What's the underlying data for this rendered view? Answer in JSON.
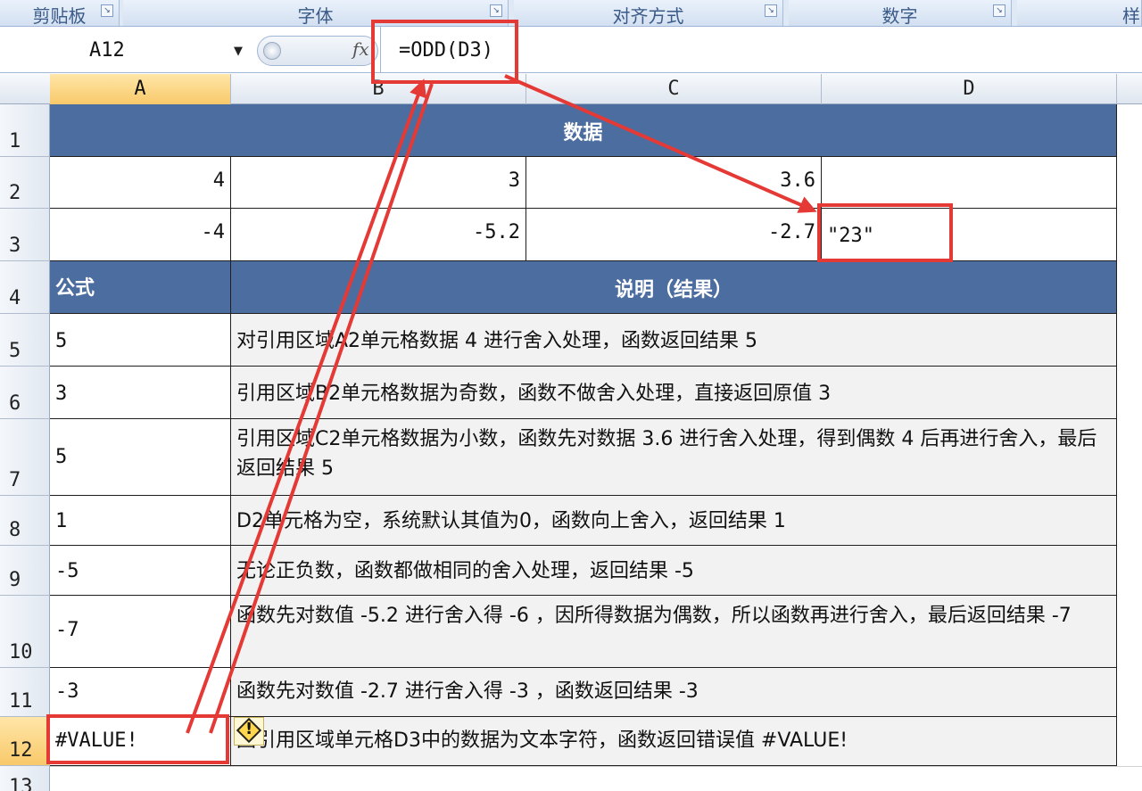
{
  "ribbon": {
    "groups": [
      {
        "label": "剪贴板"
      },
      {
        "label": "字体"
      },
      {
        "label": "对齐方式"
      },
      {
        "label": "数字"
      },
      {
        "label": "样"
      }
    ]
  },
  "formula_bar": {
    "name_box": "A12",
    "fx_label": "fx",
    "formula": "=ODD(D3)"
  },
  "columns": [
    "A",
    "B",
    "C",
    "D"
  ],
  "active_column": "A",
  "rows": [
    "1",
    "2",
    "3",
    "4",
    "5",
    "6",
    "7",
    "8",
    "9",
    "10",
    "11",
    "12",
    "13"
  ],
  "active_row": "12",
  "sheet": {
    "data_header": "数据",
    "r2": {
      "a": "4",
      "b": "3",
      "c": "3.6",
      "d": ""
    },
    "r3": {
      "a": "-4",
      "b": "-5.2",
      "c": "-2.7",
      "d": "\"23\""
    },
    "formula_header": "公式",
    "desc_header": "说明（结果）",
    "items": [
      {
        "result": "5",
        "desc": "对引用区域A2单元格数据 4 进行舍入处理，函数返回结果 5"
      },
      {
        "result": "3",
        "desc": "引用区域B2单元格数据为奇数，函数不做舍入处理，直接返回原值 3"
      },
      {
        "result": "5",
        "desc": "引用区域C2单元格数据为小数，函数先对数据 3.6 进行舍入处理，得到偶数 4 后再进行舍入，最后返回结果 5"
      },
      {
        "result": "1",
        "desc": "D2单元格为空，系统默认其值为0，函数向上舍入，返回结果 1"
      },
      {
        "result": "-5",
        "desc": "无论正负数，函数都做相同的舍入处理，返回结果 -5"
      },
      {
        "result": "-7",
        "desc": "函数先对数值 -5.2 进行舍入得 -6 ，因所得数据为偶数，所以函数再进行舍入，最后返回结果 -7"
      },
      {
        "result": "-3",
        "desc": "函数先对数值 -2.7 进行舍入得 -3 ，函数返回结果 -3"
      },
      {
        "result": "#VALUE!",
        "desc": "因引用区域单元格D3中的数据为文本字符，函数返回错误值 #VALUE!"
      }
    ]
  },
  "colors": {
    "header_fill": "#4c6d9f",
    "annotation_red": "#e53935",
    "active_header": "#f8c96a"
  }
}
